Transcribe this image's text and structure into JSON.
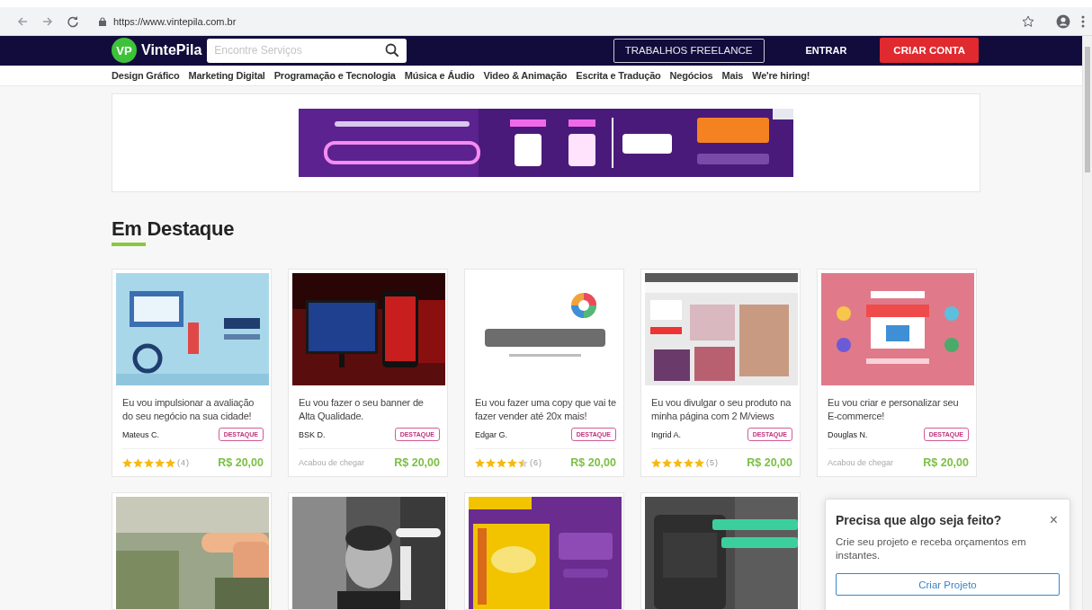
{
  "browser": {
    "url": "https://www.vintepila.com.br"
  },
  "header": {
    "logo_mark": "VP",
    "logo_text": "VintePila",
    "search": {
      "placeholder": "Encontre Serviços"
    },
    "freelance_button": "TRABALHOS FREELANCE",
    "login": "ENTRAR",
    "signup_button": "CRIAR CONTA"
  },
  "categories": [
    "Design Gráfico",
    "Marketing Digital",
    "Programação e Tecnologia",
    "Música e Áudio",
    "Video & Animação",
    "Escrita e Tradução",
    "Negócios",
    "Mais",
    "We're hiring!"
  ],
  "section_title": "Em Destaque",
  "cards": [
    {
      "kind": "rated",
      "title": "Eu vou impulsionar a avaliação do seu negócio na sua cidade!",
      "seller": "Mateus C.",
      "badge": "DESTAQUE",
      "stars": 5,
      "rating_count": "(4)",
      "price": "R$ 20,00"
    },
    {
      "kind": "new",
      "title": "Eu vou fazer o seu banner de Alta Qualidade.",
      "seller": "BSK D.",
      "badge": "DESTAQUE",
      "note": "Acabou de chegar",
      "price": "R$ 20,00"
    },
    {
      "kind": "rated",
      "title": "Eu vou fazer uma copy que vai te fazer vender até 20x mais!",
      "seller": "Edgar G.",
      "badge": "DESTAQUE",
      "stars": 4.5,
      "rating_count": "(6)",
      "price": "R$ 20,00"
    },
    {
      "kind": "rated",
      "title": "Eu vou divulgar o seu produto na minha página com 2 M/views",
      "seller": "Ingrid A.",
      "badge": "DESTAQUE",
      "stars": 5,
      "rating_count": "(5)",
      "price": "R$ 20,00"
    },
    {
      "kind": "new",
      "title": "Eu vou criar e personalizar seu E-commerce!",
      "seller": "Douglas N.",
      "badge": "DESTAQUE",
      "note": "Acabou de chegar",
      "price": "R$ 20,00"
    }
  ],
  "popup": {
    "title": "Precisa que algo seja feito?",
    "text": "Crie seu projeto e receba orçamentos em instantes.",
    "button": "Criar Projeto",
    "close": "×"
  }
}
